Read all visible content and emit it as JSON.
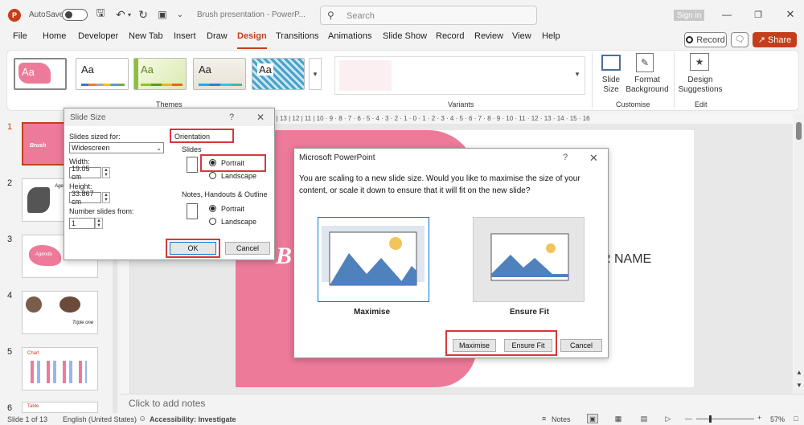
{
  "titlebar": {
    "autosave": "AutoSave",
    "doc": "Brush presentation - PowerP...",
    "search": "Search",
    "signin": "Sign in"
  },
  "tabs": [
    "File",
    "Home",
    "Developer",
    "New Tab",
    "Insert",
    "Draw",
    "Design",
    "Transitions",
    "Animations",
    "Slide Show",
    "Record",
    "Review",
    "View",
    "Help"
  ],
  "record_btn": "Record",
  "share_btn": "Share",
  "ribbon": {
    "themes_label": "Themes",
    "theme_text": "Aa",
    "variants_label": "Variants",
    "slide_size": "Slide Size",
    "format_bg": "Format Background",
    "customise": "Customise",
    "design_sugg": "Design Suggestions",
    "editor": "Edit"
  },
  "ruler": "4 | 13 | 12 | 11 | 10 · 9 · 8 · 7 · 6 · 5 · 4 · 3 · 2 · 1 · 0 · 1 · 2 · 3 · 4 · 5 · 6 · 7 · 8 · 9 · 10 · 11 · 12 · 13 · 14 · 15 · 16",
  "slides": [
    "1",
    "2",
    "3",
    "4",
    "5",
    "6"
  ],
  "thumbs": {
    "s1": "Brush",
    "s2": "Agenda",
    "s3": "Agenda",
    "s4": "Triple one",
    "s5": "Chart",
    "s6": "Table"
  },
  "slide_size": {
    "title": "Slide Size",
    "help": "?",
    "sized_for": "Slides sized for:",
    "sized_val": "Widescreen",
    "width": "Width:",
    "width_val": "19.05 cm",
    "height": "Height:",
    "height_val": "33.867 cm",
    "num": "Number slides from:",
    "num_val": "1",
    "orientation": "Orientation",
    "slides": "Slides",
    "portrait": "Portrait",
    "landscape": "Landscape",
    "notes": "Notes, Handouts & Outline",
    "portrait2": "Portrait",
    "landscape2": "Landscape",
    "ok": "OK",
    "cancel": "Cancel"
  },
  "scale_dlg": {
    "title": "Microsoft PowerPoint",
    "help": "?",
    "message": "You are scaling to a new slide size.  Would you like to maximise the size of your content, or scale it down to ensure that it will fit on the new slide?",
    "opt1": "Maximise",
    "opt2": "Ensure Fit",
    "btn_max": "Maximise",
    "btn_fit": "Ensure Fit",
    "btn_cancel": "Cancel"
  },
  "canvas": {
    "name": "R NAME",
    "b": "B"
  },
  "notes": "Click to add notes",
  "status": {
    "slide": "Slide 1 of 13",
    "lang": "English (United States)",
    "access": "Accessibility: Investigate",
    "notes": "Notes",
    "zoom": "57%"
  },
  "colors": {
    "accent": "#c43e1c",
    "pink": "#ee7a9a",
    "blue": "#4f81bd",
    "red": "#d9363e"
  }
}
